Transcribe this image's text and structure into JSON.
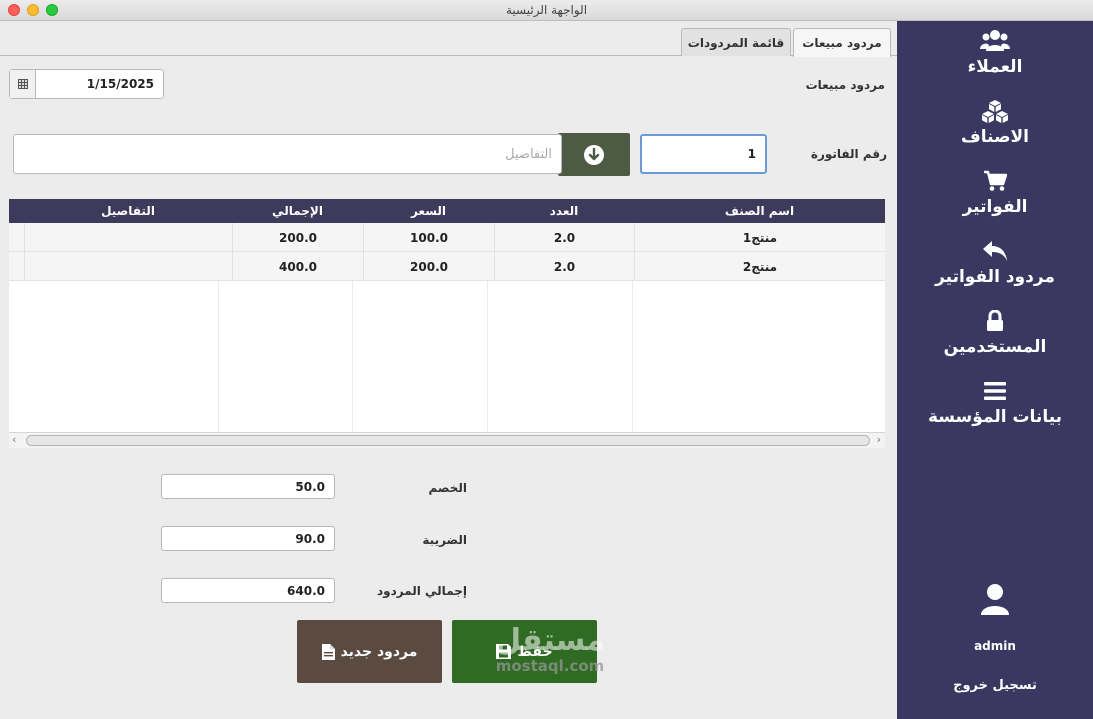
{
  "window": {
    "title": "الواجهة الرئيسية"
  },
  "tabs": [
    {
      "label": "مردود مبيعات"
    },
    {
      "label": "قائمة المردودات"
    }
  ],
  "form": {
    "section_label": "مردود مبيعات",
    "date_value": "1/15/2025",
    "invoice_label": "رقم الفاتورة",
    "invoice_value": "1",
    "details_placeholder": "التفاصيل"
  },
  "table": {
    "headers": [
      "اسم الصنف",
      "العدد",
      "السعر",
      "الإجمالي",
      "التفاصيل"
    ],
    "rows": [
      [
        "منتج1",
        "2.0",
        "100.0",
        "200.0",
        ""
      ],
      [
        "منتج2",
        "2.0",
        "200.0",
        "400.0",
        ""
      ]
    ]
  },
  "totals": {
    "discount_label": "الخصم",
    "discount_value": "50.0",
    "tax_label": "الضريبة",
    "tax_value": "90.0",
    "total_label": "إجمالي المردود",
    "total_value": "640.0"
  },
  "buttons": {
    "save_label": "حفظ",
    "new_label": "مردود جديد"
  },
  "watermark": {
    "line1": "مستقل",
    "line2": "mostaql.com"
  },
  "sidebar": {
    "items": [
      {
        "label": "العملاء",
        "icon": "users-icon"
      },
      {
        "label": "الاصناف",
        "icon": "cubes-icon"
      },
      {
        "label": "الفواتير",
        "icon": "cart-icon"
      },
      {
        "label": "مردود الفواتير",
        "icon": "reply-icon"
      },
      {
        "label": "المستخدمين",
        "icon": "lock-icon"
      },
      {
        "label": "بيانات المؤسسة",
        "icon": "menu-icon"
      }
    ],
    "username": "admin",
    "logout_label": "تسجيل خروج"
  },
  "colors": {
    "sidebar_bg": "#3a3861",
    "table_header_bg": "#3d3a5c",
    "save_button": "#2f6b22",
    "new_button": "#5a4a3f",
    "search_button": "#4d5a44"
  }
}
